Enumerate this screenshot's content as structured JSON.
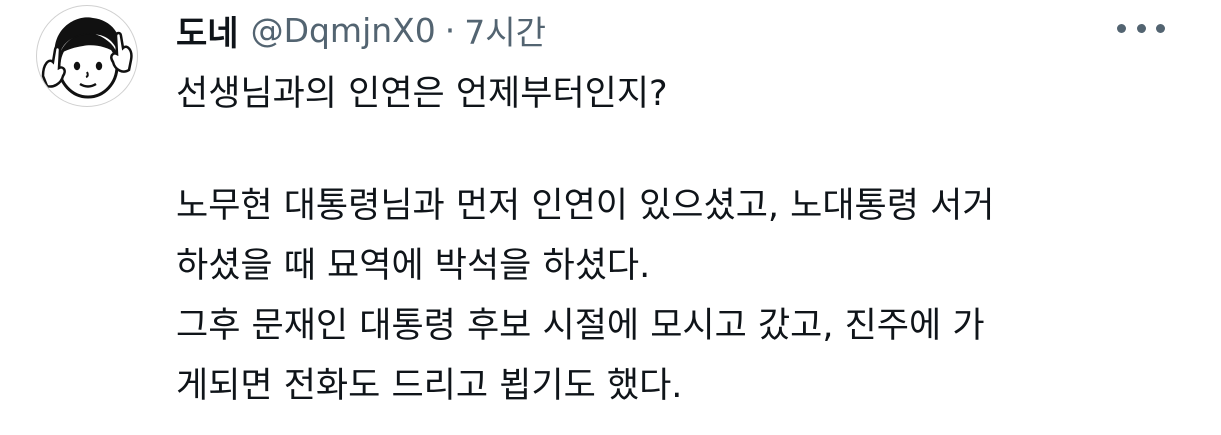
{
  "author": {
    "display_name": "도네",
    "handle": "@DqmjnX0",
    "separator": "·",
    "time": "7시간",
    "avatar_icon": "cartoon-face-avatar-icon"
  },
  "more_icon": "more-options-icon",
  "tweet": {
    "line1": "선생님과의 인연은 언제부터인지?",
    "line2": "노무현 대통령님과 먼저 인연이 있으셨고, 노대통령 서거",
    "line3": "하셨을 때 묘역에 박석을 하셨다.",
    "line4": "그후 문재인 대통령 후보 시절에 모시고 갔고, 진주에 가",
    "line5": "게되면 전화도 드리고 뵙기도 했다."
  }
}
